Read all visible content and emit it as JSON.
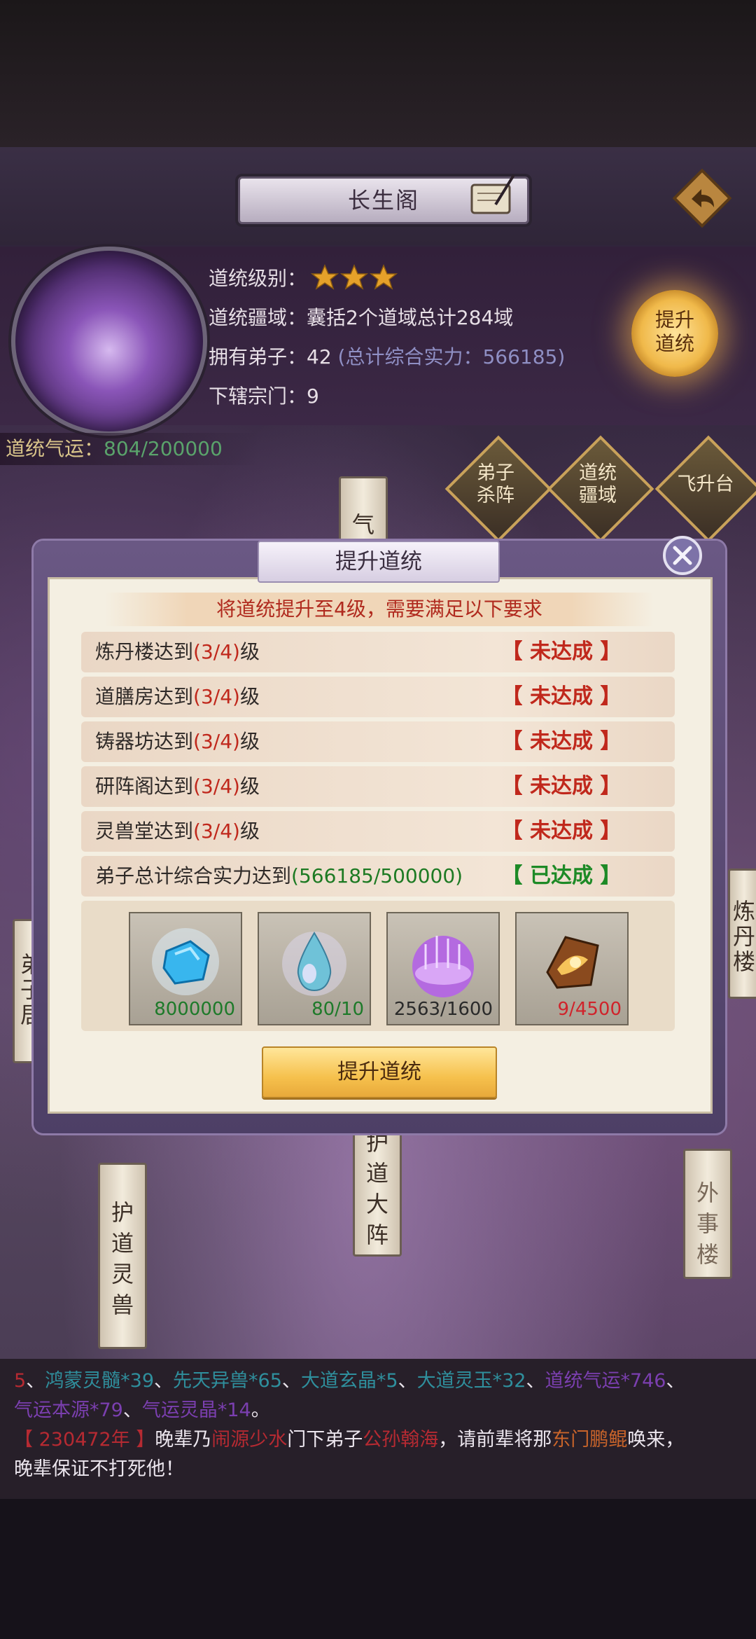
{
  "header": {
    "title": "长生阁"
  },
  "info": {
    "level_label": "道统级别：",
    "level_stars": 3,
    "domain_text": "道统疆域：囊括2个道域总计284域",
    "disciples_label": "拥有弟子：42",
    "disciples_power": "(总计综合实力：566185)",
    "subsects_text": "下辖宗门：9",
    "upgrade_label": "提升\n道统",
    "fortune_label": "道统气运：",
    "fortune_value": "804/200000"
  },
  "map_buttons": {
    "disciple_formation": "弟子\n杀阵",
    "domain": "道统\n疆域",
    "ascension": "飞升台"
  },
  "banners": {
    "qi": "气",
    "disciple_residence": "弟\n子\n居",
    "alchemy_tower": "炼\n丹\n楼",
    "guardian_beast": "护\n道\n灵\n兽",
    "guardian_array": "护\n道\n大\n阵",
    "affairs_tower": "外\n事\n楼"
  },
  "dialog": {
    "title": "提升道统",
    "requirement_banner": "将道统提升至4级，需要满足以下要求",
    "requirements": [
      {
        "text": "炼丹楼达到",
        "progress": "(3/4)",
        "suffix": "级",
        "status": "【 未达成 】",
        "met": false
      },
      {
        "text": "道膳房达到",
        "progress": "(3/4)",
        "suffix": "级",
        "status": "【 未达成 】",
        "met": false
      },
      {
        "text": "铸器坊达到",
        "progress": "(3/4)",
        "suffix": "级",
        "status": "【 未达成 】",
        "met": false
      },
      {
        "text": "研阵阁达到",
        "progress": "(3/4)",
        "suffix": "级",
        "status": "【 未达成 】",
        "met": false
      },
      {
        "text": "灵兽堂达到",
        "progress": "(3/4)",
        "suffix": "级",
        "status": "【 未达成 】",
        "met": false
      },
      {
        "text": "弟子总计综合实力达到",
        "progress": "(566185/500000)",
        "suffix": "",
        "status": "【 已达成 】",
        "met": true
      }
    ],
    "items": [
      {
        "icon": "blue-crystal-icon",
        "count": "8000000",
        "color": "#1e7a2a"
      },
      {
        "icon": "spirit-droplet-icon",
        "count": "80/10",
        "color": "#1e7a2a"
      },
      {
        "icon": "purple-aura-icon",
        "count": "2563/1600",
        "color": "#2a2a2a"
      },
      {
        "icon": "golden-relic-icon",
        "count": "9/4500",
        "color": "#d0232b"
      }
    ],
    "confirm_label": "提升道统"
  },
  "chat": {
    "line1": [
      {
        "t": "5",
        "c": "c-red"
      },
      {
        "t": "、",
        "c": "c-white"
      },
      {
        "t": "鸿蒙灵髓*39",
        "c": "c-teal"
      },
      {
        "t": "、",
        "c": "c-white"
      },
      {
        "t": "先天异兽*65",
        "c": "c-teal"
      },
      {
        "t": "、",
        "c": "c-white"
      },
      {
        "t": "大道玄晶*5",
        "c": "c-teal"
      },
      {
        "t": "、",
        "c": "c-white"
      },
      {
        "t": "大道灵玉*32",
        "c": "c-teal"
      },
      {
        "t": "、",
        "c": "c-white"
      },
      {
        "t": "道统气运*746",
        "c": "c-purple"
      },
      {
        "t": "、",
        "c": "c-white"
      }
    ],
    "line2": [
      {
        "t": "气运本源*79",
        "c": "c-purple"
      },
      {
        "t": "、",
        "c": "c-white"
      },
      {
        "t": "气运灵晶*14",
        "c": "c-purple"
      },
      {
        "t": "。",
        "c": "c-white"
      }
    ],
    "line3": [
      {
        "t": "【 230472年 】",
        "c": "c-red"
      },
      {
        "t": "晚辈乃",
        "c": "c-white"
      },
      {
        "t": "闹源少水",
        "c": "c-red"
      },
      {
        "t": "门下弟子",
        "c": "c-white"
      },
      {
        "t": "公孙翰海",
        "c": "c-red"
      },
      {
        "t": "，请前辈将那",
        "c": "c-white"
      },
      {
        "t": "东门鹏鲲",
        "c": "c-orange"
      },
      {
        "t": "唤来，",
        "c": "c-white"
      }
    ],
    "line4": [
      {
        "t": "晚辈保证不打死他！",
        "c": "c-white"
      }
    ]
  }
}
